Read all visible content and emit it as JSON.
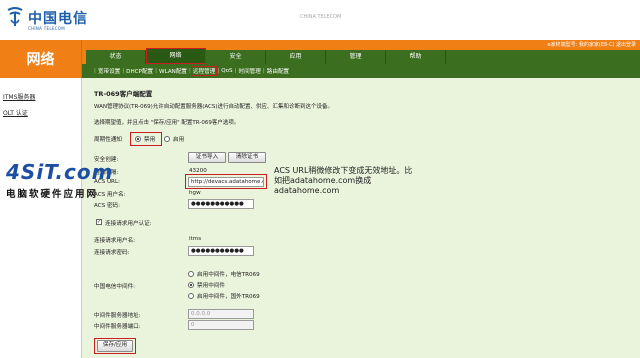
{
  "header": {
    "logo_text": "中国电信",
    "logo_sub": "CHINA TELECOM",
    "brand_right": "CHINA TELECOM",
    "user_info": "e家终端型号: 我的家家(E8-C)    退出登录"
  },
  "section_title": "网络",
  "main_nav": [
    "状态",
    "网络",
    "安全",
    "应用",
    "管理",
    "帮助"
  ],
  "main_nav_active": 1,
  "sub_nav": [
    "宽带设置",
    "DHCP配置",
    "WLAN配置",
    "远程管理",
    "QoS",
    "时间管理",
    "路由配置"
  ],
  "sub_nav_active": 3,
  "sidebar": {
    "items": [
      "ITMS服务器",
      "OLT 认证"
    ]
  },
  "form": {
    "title": "TR-069客户端配置",
    "description": "WAN管理协议(TR-069)允许自动配置服务器(ACS)进行自动配置、供应、汇集和诊断到这个设备。",
    "hint": "选择期望值，并且点击 \"保存/应用\" 配置TR-069客户选项。",
    "periodic_inform_label": "周期性通知",
    "periodic_options": [
      "禁用",
      "启用"
    ],
    "periodic_selected": 0,
    "security_cert_label": "安全创建:",
    "cert_import_button": "证书导入",
    "cert_clear_button": "清除证书",
    "inform_interval_label": "通知间隔:",
    "inform_interval_value": "43200",
    "acs_url_label": "ACS URL:",
    "acs_url_value": "http://devacs.adatahome.c",
    "acs_user_label": "ACS 用户名:",
    "acs_user_value": "hgw",
    "acs_password_label": "ACS 密码:",
    "acs_password_value": "●●●●●●●●●●●",
    "conn_auth_label": "连接请求用户认证:",
    "conn_user_label": "连接请求用户名:",
    "conn_user_value": "itms",
    "conn_password_label": "连接请求密码:",
    "conn_password_value": "●●●●●●●●●●●",
    "middleware_label": "中国电信中间件:",
    "middleware_options": [
      "启用中间件，电信TR069",
      "禁用中间件",
      "启用中间件，国外TR069"
    ],
    "middleware_selected": 1,
    "middleware_addr_label": "中间件服务器地址:",
    "middleware_addr_value": "0.0.0.0",
    "middleware_port_label": "中间件服务器端口:",
    "middleware_port_value": "0",
    "save_button": "保存/应用"
  },
  "annotation": {
    "text": "ACS URL稍微修改下变成无效地址。比如把adatahome.com换成adatahome.com"
  },
  "watermark": {
    "logo": "4SiT.com",
    "sub": "电脑软硬件应用网"
  }
}
